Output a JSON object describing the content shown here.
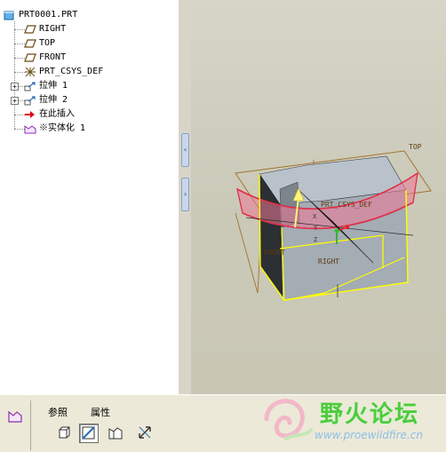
{
  "model_tree": {
    "root": "PRT0001.PRT",
    "items": [
      {
        "label": "RIGHT",
        "icon": "datum-plane-icon"
      },
      {
        "label": "TOP",
        "icon": "datum-plane-icon"
      },
      {
        "label": "FRONT",
        "icon": "datum-plane-icon"
      },
      {
        "label": "PRT_CSYS_DEF",
        "icon": "csys-icon"
      },
      {
        "label": "拉伸 1",
        "icon": "extrude-icon",
        "expandable": true
      },
      {
        "label": "拉伸 2",
        "icon": "extrude-icon",
        "expandable": true
      },
      {
        "label": "在此插入",
        "icon": "insert-here-arrow-icon"
      },
      {
        "label": "※实体化 1",
        "icon": "solidify-icon"
      }
    ]
  },
  "viewport": {
    "labels": {
      "top": "TOP",
      "csys": "PRT_CSYS_DEF",
      "front": "FRONT",
      "right": "RIGHT",
      "axis_x": "X",
      "axis_y": "Y",
      "axis_z": "Z"
    },
    "colors": {
      "background": "#cfcdbd",
      "datum_plane": "#a1742e",
      "selected_edge": "#ffff00",
      "quilt": "#e0304a",
      "solid": "#9ba4ad"
    }
  },
  "dashboard": {
    "tabs": [
      "参照",
      "属性"
    ],
    "tools": [
      {
        "name": "solid-volume-icon",
        "pressed": false
      },
      {
        "name": "remove-material-icon",
        "pressed": true
      },
      {
        "name": "surface-patch-icon",
        "pressed": false
      },
      {
        "name": "flip-direction-icon",
        "pressed": false
      }
    ]
  },
  "watermark": {
    "title": "野火论坛",
    "url": "www.proewildfire.cn"
  }
}
